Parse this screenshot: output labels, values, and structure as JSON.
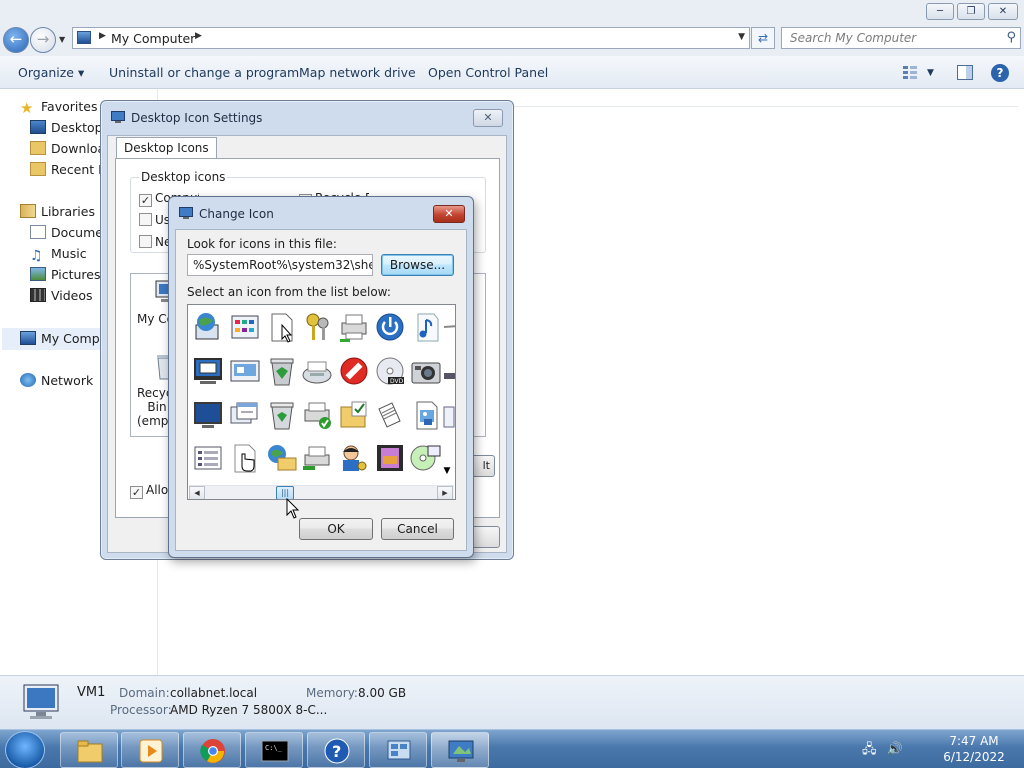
{
  "window": {
    "caption_buttons": [
      "minimize",
      "maximize",
      "close"
    ]
  },
  "address": {
    "breadcrumb": "My Computer",
    "search_placeholder": "Search My Computer"
  },
  "toolbar": {
    "organize": "Organize",
    "uninstall": "Uninstall or change a program",
    "map_drive": "Map network drive",
    "control_panel": "Open Control Panel"
  },
  "nav": {
    "favorites": "Favorites",
    "desktop": "Desktop",
    "downloads": "Downloads",
    "recent": "Recent Places",
    "libraries": "Libraries",
    "documents": "Documents",
    "music": "Music",
    "pictures": "Pictures",
    "videos": "Videos",
    "my_computer": "My Computer",
    "network": "Network"
  },
  "details": {
    "name": "VM1",
    "domain_label": "Domain:",
    "domain": "collabnet.local",
    "memory_label": "Memory:",
    "memory": "8.00 GB",
    "processor_label": "Processor:",
    "processor": "AMD Ryzen 7 5800X 8-C..."
  },
  "desktop_icon_settings": {
    "title": "Desktop Icon Settings",
    "tab": "Desktop Icons",
    "group_label": "Desktop icons",
    "checks": {
      "computer": "Computer",
      "recycle_bin": "Recycle Bin",
      "user_files": "User's Files",
      "network": "Network"
    },
    "icon_labels": {
      "my_computer": "My Computer",
      "recycle_empty": "Recycle Bin (empty)"
    },
    "allow_themes": "Allow themes to change desktop icons"
  },
  "change_icon": {
    "title": "Change Icon",
    "look_label": "Look for icons in this file:",
    "path": "%SystemRoot%\\system32\\shell32.dll",
    "browse": "Browse...",
    "select_label": "Select an icon from the list below:",
    "ok": "OK",
    "cancel": "Cancel",
    "icons": [
      "globe-computer-icon",
      "control-panel-icon",
      "document-pointer-icon",
      "keys-icon",
      "printer-network-icon",
      "power-icon",
      "music-note-icon",
      "cable-icon",
      "monitor-window-icon",
      "display-properties-icon",
      "recycle-bin-full-icon",
      "fax-icon",
      "blocked-icon",
      "dvd-icon",
      "camera-icon",
      "drive-icon",
      "monitor-blue-icon",
      "windows-stack-icon",
      "recycle-bin-icon",
      "printer-check-icon",
      "folder-check-icon",
      "documents-icon",
      "picture-document-icon",
      "partial-icon",
      "list-view-icon",
      "hand-pointer-icon",
      "network-globe-folder-icon",
      "printer-green-icon",
      "user-key-icon",
      "film-strip-icon",
      "cd-network-icon",
      "scroll-down-icon"
    ]
  },
  "taskbar": {
    "apps": [
      "explorer-icon",
      "media-player-icon",
      "chrome-icon",
      "cmd-icon",
      "help-icon",
      "remote-desktop-icon",
      "desktop-settings-icon"
    ],
    "time": "7:47 AM",
    "date": "6/12/2022"
  }
}
